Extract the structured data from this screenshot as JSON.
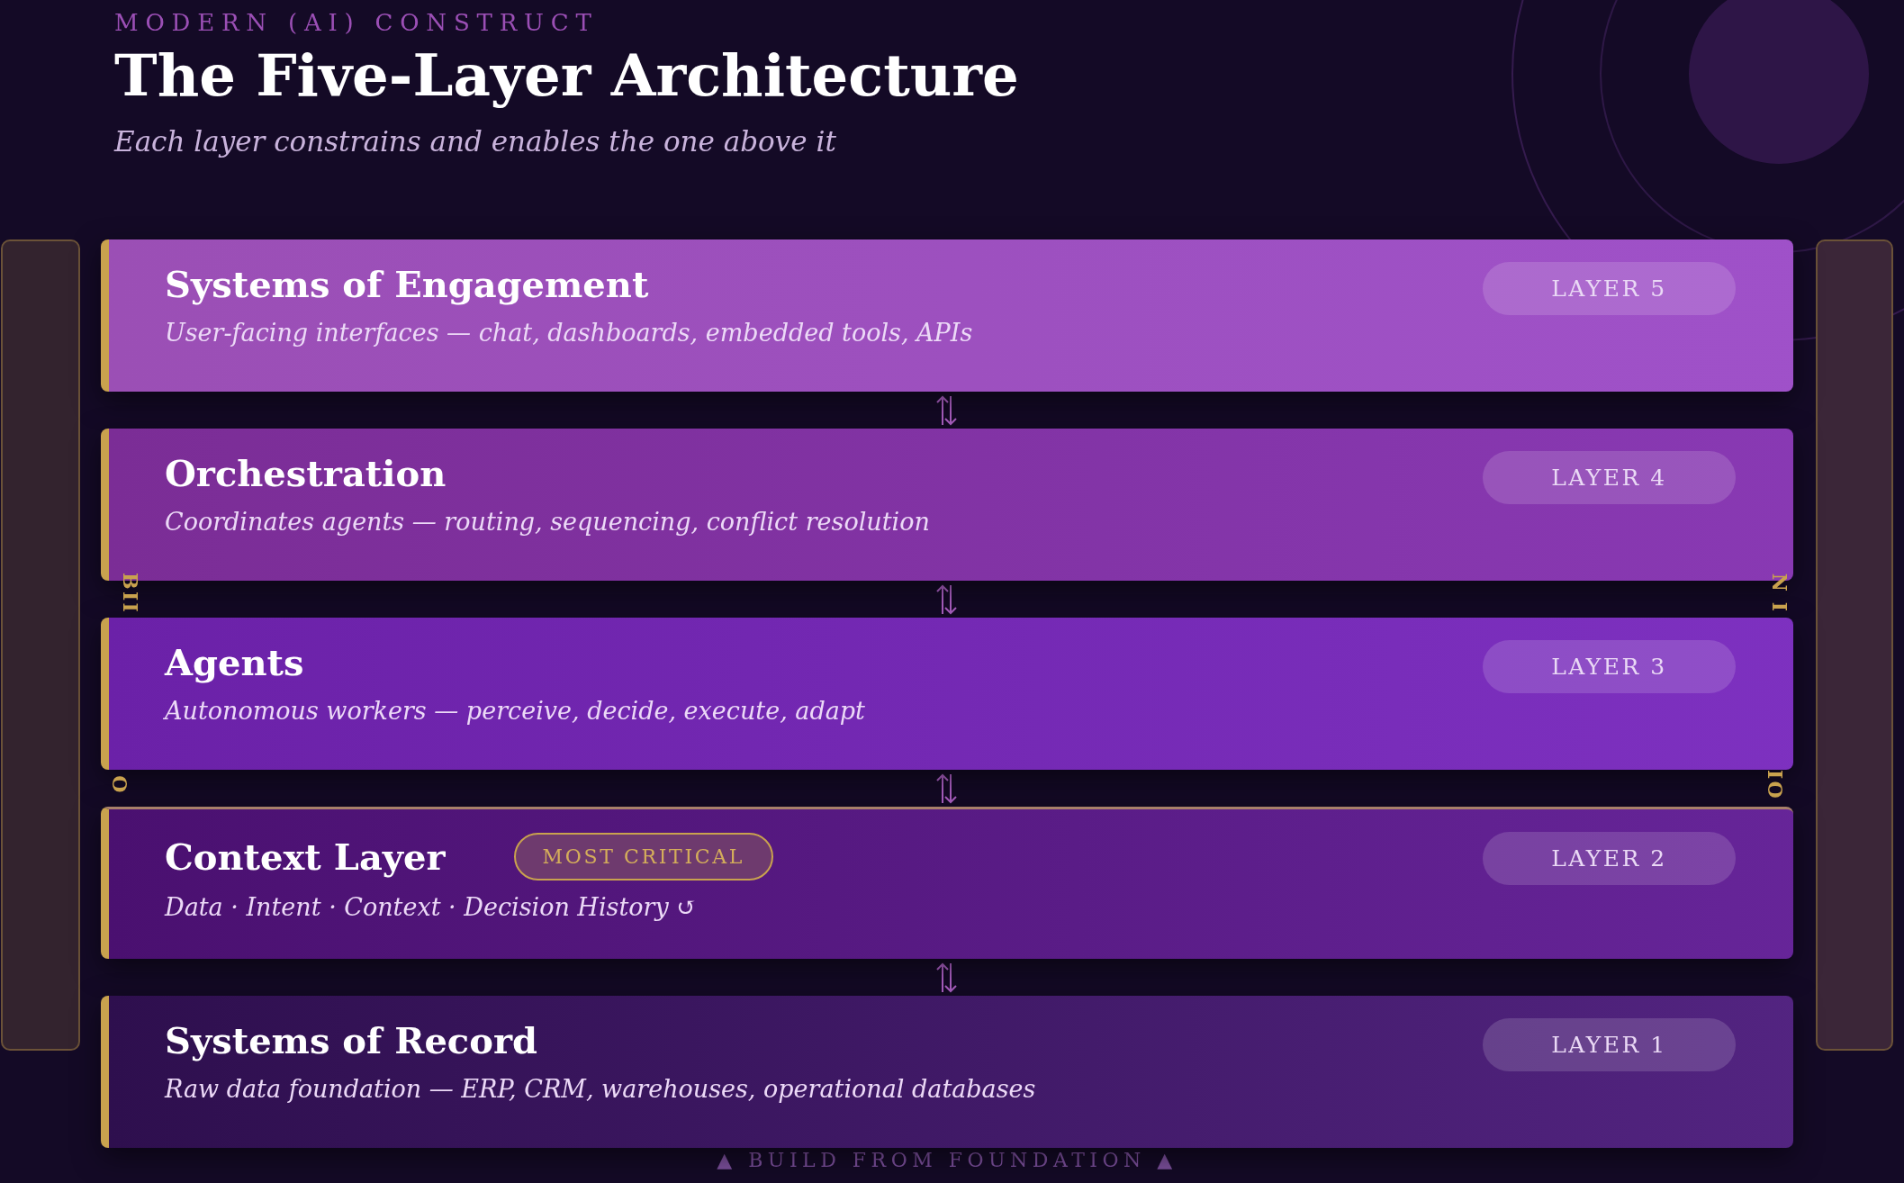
{
  "header": {
    "kicker": "MODERN (AI) CONSTRUCT",
    "title": "The Five-Layer Architecture",
    "subtitle": "Each layer constrains and enables the one above it"
  },
  "left_rail": {
    "fragments": [
      "BII",
      "O"
    ]
  },
  "right_rail": {
    "fragments": [
      "N I",
      "IO"
    ]
  },
  "layers": [
    {
      "title": "Systems of Engagement",
      "description": "User-facing interfaces — chat, dashboards, embedded tools, APIs",
      "badge": "LAYER 5",
      "highlighted": false,
      "color": "#9b4fb5"
    },
    {
      "title": "Orchestration",
      "description": "Coordinates agents — routing, sequencing, conflict resolution",
      "badge": "LAYER 4",
      "highlighted": false,
      "color": "#7b2d96"
    },
    {
      "title": "Agents",
      "description": "Autonomous workers — perceive, decide, execute, adapt",
      "badge": "LAYER 3",
      "highlighted": false,
      "color": "#6b21a8"
    },
    {
      "title": "Context Layer",
      "description": "Data · Intent · Context · Decision History ↺",
      "badge": "LAYER 2",
      "highlighted": true,
      "tag": "MOST CRITICAL",
      "color": "#4a1070"
    },
    {
      "title": "Systems of Record",
      "description": "Raw data foundation — ERP, CRM, warehouses, operational databases",
      "badge": "LAYER 1",
      "highlighted": false,
      "color": "#2e0f4e"
    }
  ],
  "footer": "▲ BUILD FROM FOUNDATION ▲"
}
